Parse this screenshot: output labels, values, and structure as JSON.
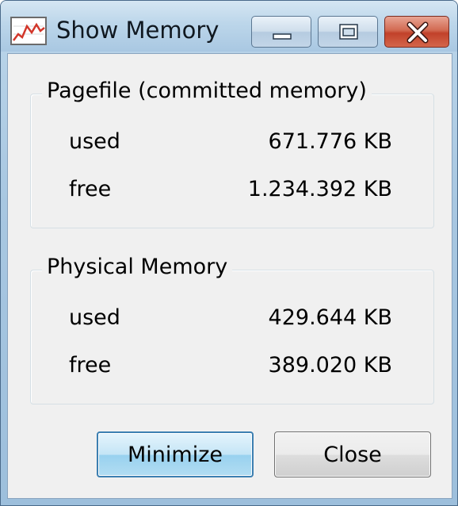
{
  "window": {
    "title": "Show Memory",
    "icon": "memory-graph-icon"
  },
  "caption_buttons": {
    "minimize_icon": "minimize-icon",
    "maximize_icon": "maximize-icon",
    "close_icon": "close-icon",
    "close_color": "#c8442b"
  },
  "pagefile": {
    "legend": "Pagefile (committed memory)",
    "used_label": "used",
    "used_value": "671.776 KB",
    "free_label": "free",
    "free_value": "1.234.392 KB"
  },
  "physical": {
    "legend": "Physical Memory",
    "used_label": "used",
    "used_value": "429.644 KB",
    "free_label": "free",
    "free_value": "389.020 KB"
  },
  "buttons": {
    "minimize_label": "Minimize",
    "close_label": "Close"
  }
}
